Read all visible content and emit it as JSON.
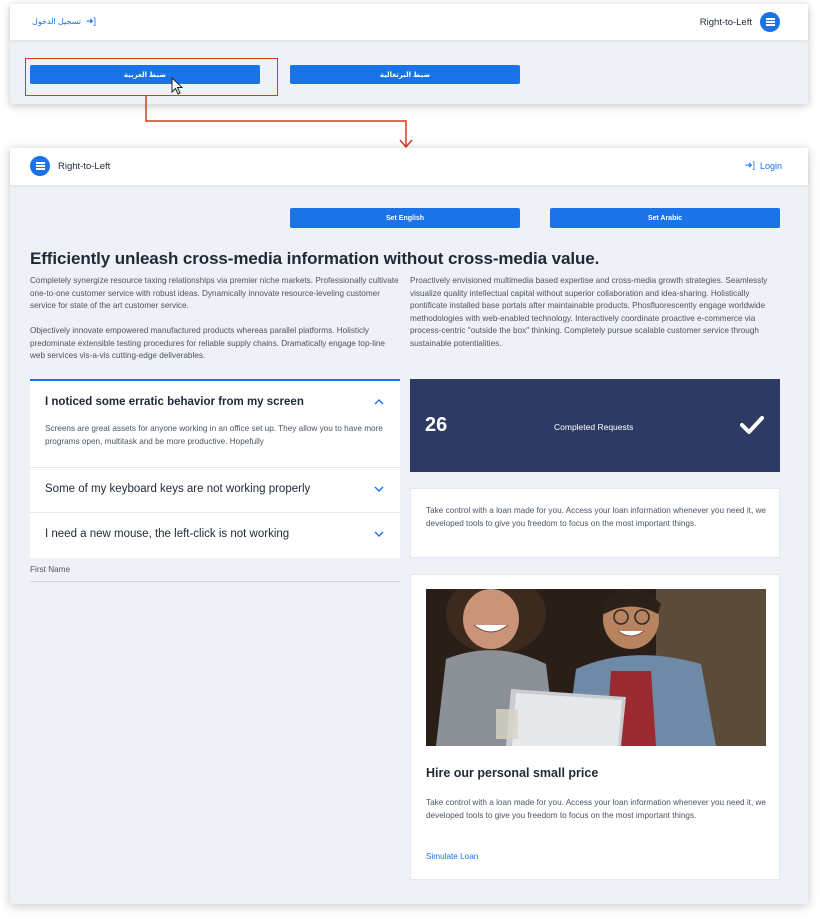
{
  "rtl_view": {
    "brand": "Right-to-Left",
    "login_label": "تسجيل الدخول",
    "buttons": {
      "arabic": "ضبط العربية",
      "portuguese": "ضبط البرتغالية"
    }
  },
  "ltr_view": {
    "brand": "Right-to-Left",
    "login_label": "Login",
    "buttons": {
      "set_english": "Set English",
      "set_arabic": "Set Arabic"
    },
    "headline": "Efficiently unleash cross-media information without cross-media value.",
    "paragraphs": {
      "left_1": "Completely synergize resource taxing relationships via premier niche markets. Professionally cultivate one-to-one customer service with robust ideas. Dynamically innovate resource-leveling customer service for state of the art customer service.",
      "left_2": "Objectively innovate empowered manufactured products whereas parallel platforms. Holisticly predominate extensible testing procedures for reliable supply chains. Dramatically engage top-line web services vis-a-vis cutting-edge deliverables.",
      "right": "Proactively envisioned multimedia based expertise and cross-media growth strategies. Seamlessly visualize quality intellectual capital without superior collaboration and idea-sharing. Holistically pontificate installed base portals after maintainable products. Phosfluorescently engage worldwide methodologies with web-enabled technology. Interactively coordinate proactive e-commerce via process-centric \"outside the box\" thinking. Completely pursue scalable customer service through sustainable potentialities."
    },
    "accordion": [
      {
        "title": "I noticed some erratic behavior from my screen",
        "body": "Screens are great assets for anyone working in an office set up. They allow you to have more programs open, multitask and be more productive. Hopefully",
        "open": true
      },
      {
        "title": "Some of my keyboard keys are not working properly",
        "open": false
      },
      {
        "title": "I need a new mouse, the left-click is not working",
        "open": false
      }
    ],
    "form": {
      "first_name_label": "First Name"
    },
    "stat": {
      "value": "26",
      "label": "Completed Requests"
    },
    "info_text": "Take control with a loan made for you. Access your loan information whenever you need it, we developed tools to give you freedom to focus on the most important things.",
    "promo_card": {
      "title": "Hire our personal small price",
      "text": "Take control with a loan made for you. Access your loan information whenever you need it, we developed tools to give you freedom to focus on the most important things.",
      "link": "Simulate Loan"
    }
  },
  "colors": {
    "accent": "#1a73e8",
    "highlight": "#d63a22",
    "stat_bg": "#2d3a63",
    "panel_bg": "#eef1f5"
  },
  "icons": [
    "sign-in-icon",
    "logo-icon",
    "chevron-up-icon",
    "chevron-down-icon",
    "checkmark-icon",
    "mouse-cursor-icon"
  ]
}
